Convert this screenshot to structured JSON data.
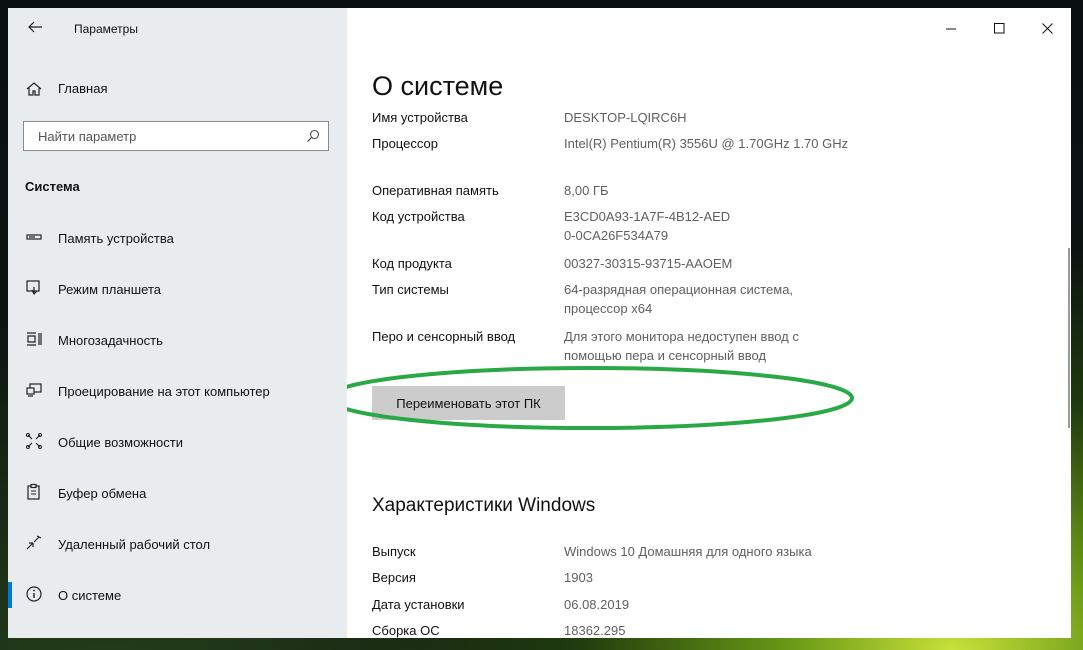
{
  "window": {
    "title": "Параметры",
    "controls": {
      "minimize": "—",
      "maximize": "☐",
      "close": "✕"
    }
  },
  "sidebar": {
    "home_label": "Главная",
    "search_placeholder": "Найти параметр",
    "section": "Система",
    "items": [
      {
        "label": "Память устройства",
        "icon": "storage-icon"
      },
      {
        "label": "Режим планшета",
        "icon": "tablet-mode-icon"
      },
      {
        "label": "Многозадачность",
        "icon": "multitasking-icon"
      },
      {
        "label": "Проецирование на этот компьютер",
        "icon": "projecting-icon"
      },
      {
        "label": "Общие возможности",
        "icon": "shared-experiences-icon"
      },
      {
        "label": "Буфер обмена",
        "icon": "clipboard-icon"
      },
      {
        "label": "Удаленный рабочий стол",
        "icon": "remote-desktop-icon"
      },
      {
        "label": "О системе",
        "icon": "info-icon",
        "active": true
      }
    ]
  },
  "main": {
    "title": "О системе",
    "device_specs": [
      {
        "key": "Имя устройства",
        "value": "DESKTOP-LQIRC6H"
      },
      {
        "key": "Процессор",
        "value": "Intel(R) Pentium(R) 3556U @ 1.70GHz   1.70 GHz"
      },
      {
        "key": "Оперативная память",
        "value": "8,00 ГБ"
      },
      {
        "key": "Код устройства",
        "value": "E3CD0A93-1A7F-4B12-AED0-0CA26F534A79"
      },
      {
        "key": "Код продукта",
        "value": "00327-30315-93715-AAOEM"
      },
      {
        "key": "Тип системы",
        "value": "64-разрядная операционная система, процессор x64"
      },
      {
        "key": "Перо и сенсорный ввод",
        "value": "Для этого монитора недоступен ввод с помощью пера и сенсорный ввод"
      }
    ],
    "rename_button": "Переименовать этот ПК",
    "windows_section_title": "Характеристики Windows",
    "windows_specs": [
      {
        "key": "Выпуск",
        "value": "Windows 10 Домашняя для одного языка"
      },
      {
        "key": "Версия",
        "value": "1903"
      },
      {
        "key": "Дата установки",
        "value": "06.08.2019"
      },
      {
        "key": "Сборка ОС",
        "value": "18362.295"
      }
    ]
  },
  "colors": {
    "accent": "#0078d7",
    "highlight": "#2aa845",
    "sidebar_bg": "#e9ecef"
  }
}
